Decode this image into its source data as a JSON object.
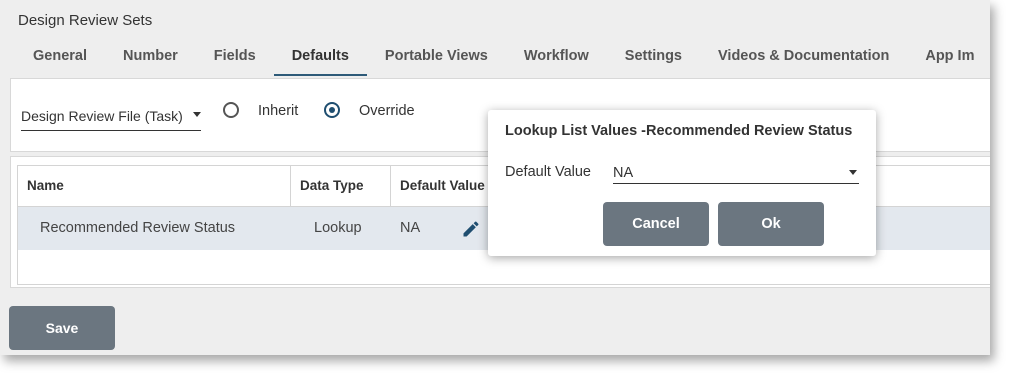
{
  "header": {
    "title": "Design Review Sets"
  },
  "tabs": [
    {
      "label": "General"
    },
    {
      "label": "Number"
    },
    {
      "label": "Fields"
    },
    {
      "label": "Defaults"
    },
    {
      "label": "Portable Views"
    },
    {
      "label": "Workflow"
    },
    {
      "label": "Settings"
    },
    {
      "label": "Videos & Documentation"
    },
    {
      "label": "App Im"
    }
  ],
  "active_tab": "Defaults",
  "defaults": {
    "type_select": {
      "value": "Design Review File (Task)"
    },
    "inherit_label": "Inherit",
    "override_label": "Override",
    "selected_option": "Override"
  },
  "table": {
    "columns": {
      "name": "Name",
      "data_type": "Data Type",
      "default_value": "Default Value"
    },
    "rows": [
      {
        "name": "Recommended Review Status",
        "data_type": "Lookup",
        "default_value": "NA"
      }
    ]
  },
  "save_label": "Save",
  "dialog": {
    "title": "Lookup List Values -Recommended Review Status",
    "field_label": "Default Value",
    "field_value": "NA",
    "cancel_label": "Cancel",
    "ok_label": "Ok"
  },
  "colors": {
    "accent": "#1f4e70",
    "button": "#6b7680",
    "selected_row": "#e3e8ee"
  }
}
